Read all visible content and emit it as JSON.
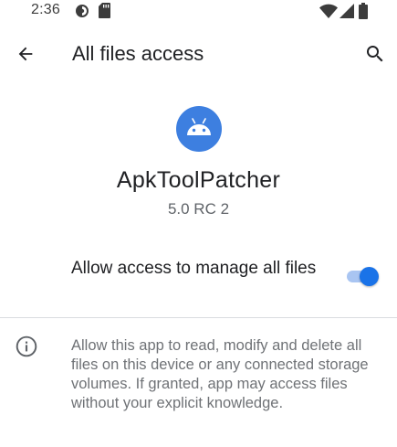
{
  "status_bar": {
    "time": "2:36",
    "icons": [
      "data-saver-icon",
      "sd-card-icon",
      "wifi-icon",
      "signal-icon",
      "battery-icon"
    ]
  },
  "app_bar": {
    "title": "All files access",
    "back_icon": "arrow-back-icon",
    "search_icon": "search-icon"
  },
  "app": {
    "name": "ApkToolPatcher",
    "version": "5.0 RC 2",
    "icon": "android-icon",
    "icon_color": "#3d7fe0"
  },
  "permission": {
    "label": "Allow access to manage all files",
    "enabled": true,
    "accent": "#1a73e8"
  },
  "info": {
    "icon": "info-icon",
    "text": "Allow this app to read, modify and delete all files on this device or any connected storage volumes. If granted, app may access files without your explicit knowledge."
  }
}
